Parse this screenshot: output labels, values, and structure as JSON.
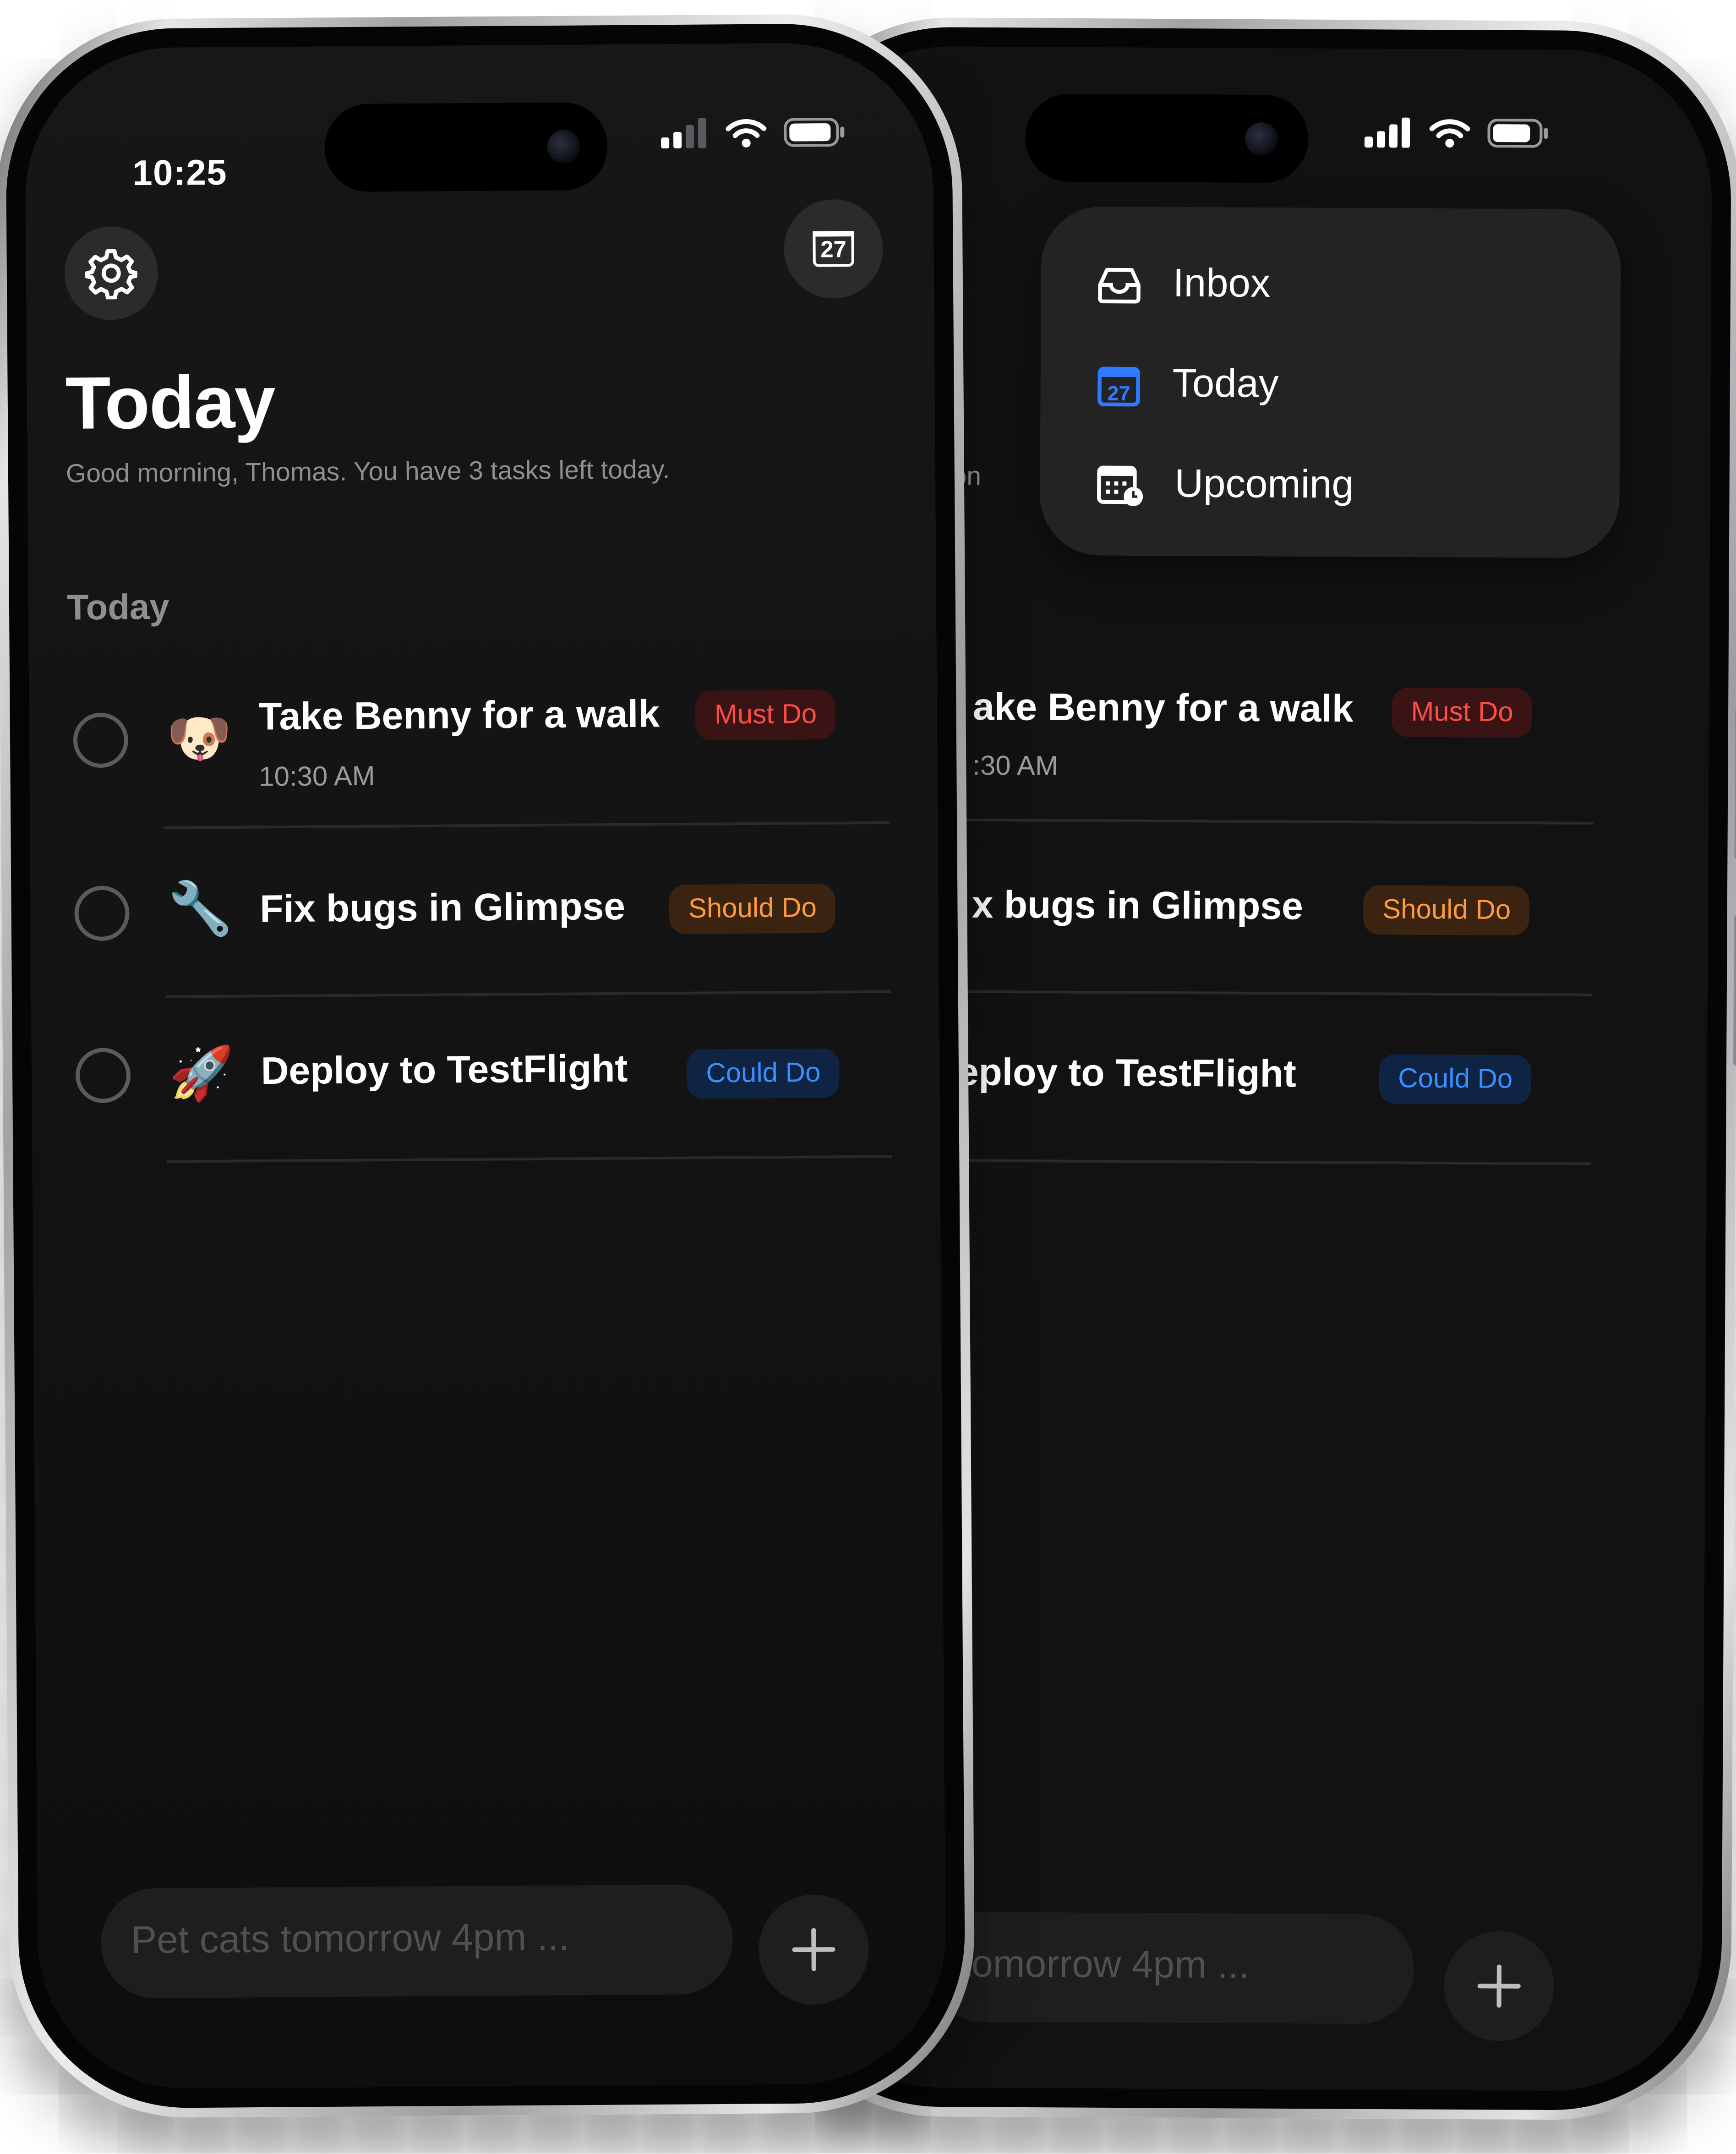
{
  "left_phone": {
    "status": {
      "time": "10:25"
    },
    "header": {
      "title": "Today",
      "subtitle": "Good morning, Thomas. You have 3 tasks left today.",
      "calendar_day": "27"
    },
    "section_title": "Today",
    "tasks": [
      {
        "emoji": "🐶",
        "title": "Take Benny for a walk",
        "time": "10:30 AM",
        "tag": "Must Do"
      },
      {
        "emoji": "🔧",
        "title": "Fix bugs in Glimpse",
        "time": "",
        "tag": "Should Do"
      },
      {
        "emoji": "🚀",
        "title": "Deploy to TestFlight",
        "time": "",
        "tag": "Could Do"
      }
    ],
    "input": {
      "placeholder": "Pet cats tomorrow 4pm ..."
    }
  },
  "right_phone": {
    "menu": [
      {
        "label": "Inbox",
        "icon": "inbox-tray-icon"
      },
      {
        "label": "Today",
        "icon": "calendar-today-icon",
        "day": "27"
      },
      {
        "label": "Upcoming",
        "icon": "calendar-upcoming-icon"
      }
    ],
    "subtitle_fragment": "on",
    "tasks": [
      {
        "title": "ake Benny for a walk",
        "time": ":30 AM",
        "tag": "Must Do"
      },
      {
        "title": "x bugs in Glimpse",
        "tag": "Should Do"
      },
      {
        "title": "eploy to TestFlight",
        "tag": "Could Do"
      }
    ],
    "input": {
      "placeholder": "tomorrow 4pm ..."
    }
  },
  "colors": {
    "must": "#ff4d45",
    "should": "#ff9a3d",
    "could": "#3a8eff",
    "background": "#121212"
  }
}
